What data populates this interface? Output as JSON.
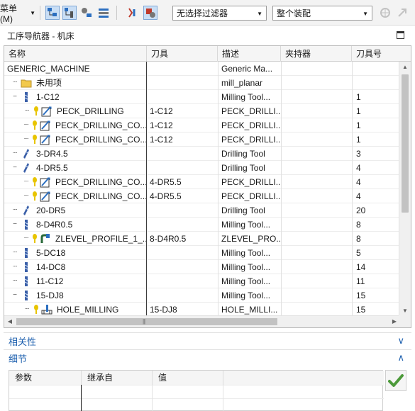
{
  "toolbar": {
    "menu_label": "菜单(M)",
    "filter_select": "无选择过滤器",
    "assembly_select": "整个装配",
    "icons": [
      "program-order-view-icon",
      "machine-tool-view-icon",
      "geometry-view-icon",
      "method-view-icon",
      "find-icon",
      "selected-filter-icon",
      "snap-icon",
      "arrow-icon"
    ]
  },
  "panel": {
    "title": "工序导航器 - 机床"
  },
  "tree": {
    "columns": [
      "名称",
      "刀具",
      "描述",
      "夹持器",
      "刀具号"
    ],
    "rows": [
      {
        "name": "GENERIC_MACHINE",
        "tool": "",
        "desc": "Generic Ma...",
        "holder": "",
        "num": "",
        "icon": "machine-icon"
      },
      {
        "name": "未用项",
        "tool": "",
        "desc": "mill_planar",
        "holder": "",
        "num": "",
        "icon": "folder-icon"
      },
      {
        "name": "1-C12",
        "tool": "",
        "desc": "Milling Tool...",
        "holder": "",
        "num": "1",
        "icon": "mill-tool-icon"
      },
      {
        "name": "PECK_DRILLING",
        "tool": "1-C12",
        "desc": "PECK_DRILLI...",
        "holder": "",
        "num": "1",
        "icon": "drilling-op-icon"
      },
      {
        "name": "PECK_DRILLING_CO...",
        "tool": "1-C12",
        "desc": "PECK_DRILLI...",
        "holder": "",
        "num": "1",
        "icon": "drilling-op-icon"
      },
      {
        "name": "PECK_DRILLING_CO...",
        "tool": "1-C12",
        "desc": "PECK_DRILLI...",
        "holder": "",
        "num": "1",
        "icon": "drilling-op-icon"
      },
      {
        "name": "3-DR4.5",
        "tool": "",
        "desc": "Drilling Tool",
        "holder": "",
        "num": "3",
        "icon": "drill-tool-icon"
      },
      {
        "name": "4-DR5.5",
        "tool": "",
        "desc": "Drilling Tool",
        "holder": "",
        "num": "4",
        "icon": "drill-tool-icon"
      },
      {
        "name": "PECK_DRILLING_CO...",
        "tool": "4-DR5.5",
        "desc": "PECK_DRILLI...",
        "holder": "",
        "num": "4",
        "icon": "drilling-op-icon"
      },
      {
        "name": "PECK_DRILLING_CO...",
        "tool": "4-DR5.5",
        "desc": "PECK_DRILLI...",
        "holder": "",
        "num": "4",
        "icon": "drilling-op-icon"
      },
      {
        "name": "20-DR5",
        "tool": "",
        "desc": "Drilling Tool",
        "holder": "",
        "num": "20",
        "icon": "drill-tool-icon"
      },
      {
        "name": "8-D4R0.5",
        "tool": "",
        "desc": "Milling Tool...",
        "holder": "",
        "num": "8",
        "icon": "mill-tool-icon"
      },
      {
        "name": "ZLEVEL_PROFILE_1_...",
        "tool": "8-D4R0.5",
        "desc": "ZLEVEL_PRO...",
        "holder": "",
        "num": "8",
        "icon": "zlevel-op-icon"
      },
      {
        "name": "5-DC18",
        "tool": "",
        "desc": "Milling Tool...",
        "holder": "",
        "num": "5",
        "icon": "mill-tool-icon"
      },
      {
        "name": "14-DC8",
        "tool": "",
        "desc": "Milling Tool...",
        "holder": "",
        "num": "14",
        "icon": "mill-tool-icon"
      },
      {
        "name": "11-C12",
        "tool": "",
        "desc": "Milling Tool...",
        "holder": "",
        "num": "11",
        "icon": "mill-tool-icon"
      },
      {
        "name": "15-DJ8",
        "tool": "",
        "desc": "Milling Tool...",
        "holder": "",
        "num": "15",
        "icon": "mill-tool-icon"
      },
      {
        "name": "HOLE_MILLING",
        "tool": "15-DJ8",
        "desc": "HOLE_MILLI...",
        "holder": "",
        "num": "15",
        "icon": "hole-milling-op-icon"
      }
    ]
  },
  "sections": {
    "dependencies": "相关性",
    "details": "细节"
  },
  "details_table": {
    "columns": [
      "参数",
      "继承自",
      "值"
    ]
  },
  "colors": {
    "accent": "#1c5fae",
    "warning": "#e8c400",
    "ok_green": "#4c9a3a"
  }
}
